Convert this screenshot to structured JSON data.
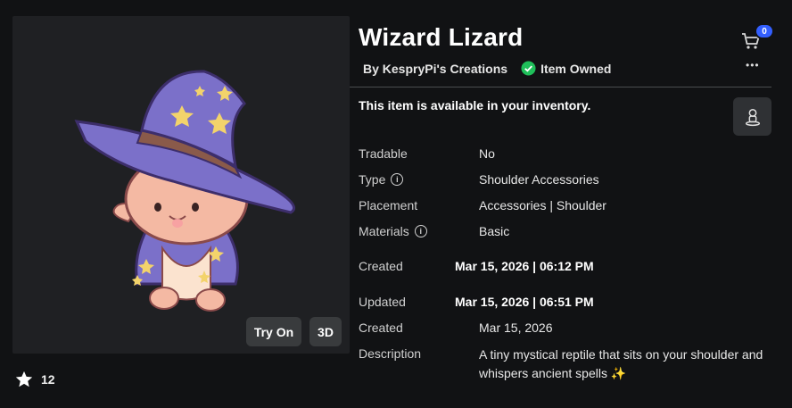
{
  "item": {
    "title": "Wizard Lizard",
    "creator": "By KespryPi's Creations",
    "owned_label": "Item Owned",
    "availability": "This item is available in your inventory.",
    "description": "A tiny mystical reptile that sits on your shoulder and whispers ancient spells ✨"
  },
  "preview": {
    "try_on_label": "Try On",
    "three_d_label": "3D"
  },
  "favorites": {
    "count": "12"
  },
  "cart": {
    "badge_count": "0"
  },
  "details": {
    "tradable": {
      "label": "Tradable",
      "value": "No"
    },
    "type": {
      "label": "Type",
      "value": "Shoulder Accessories"
    },
    "placement": {
      "label": "Placement",
      "value": "Accessories | Shoulder"
    },
    "materials": {
      "label": "Materials",
      "value": "Basic"
    },
    "created_datetime": {
      "label": "Created",
      "value": "Mar 15, 2026 | 06:12 PM"
    },
    "updated_datetime": {
      "label": "Updated",
      "value": "Mar 15, 2026 | 06:51 PM"
    },
    "created_date": {
      "label": "Created",
      "value": "Mar 15, 2026"
    },
    "description_label": "Description"
  },
  "colors": {
    "owned_green": "#1fbf5a",
    "badge_blue": "#335fff",
    "hat_purple": "#7b70c9",
    "star_yellow": "#f3d36b",
    "skin_peach": "#f4b9a3"
  },
  "icons": [
    "star-icon",
    "check-circle-icon",
    "cart-icon",
    "more-icon",
    "avatar-icon",
    "info-icon"
  ]
}
